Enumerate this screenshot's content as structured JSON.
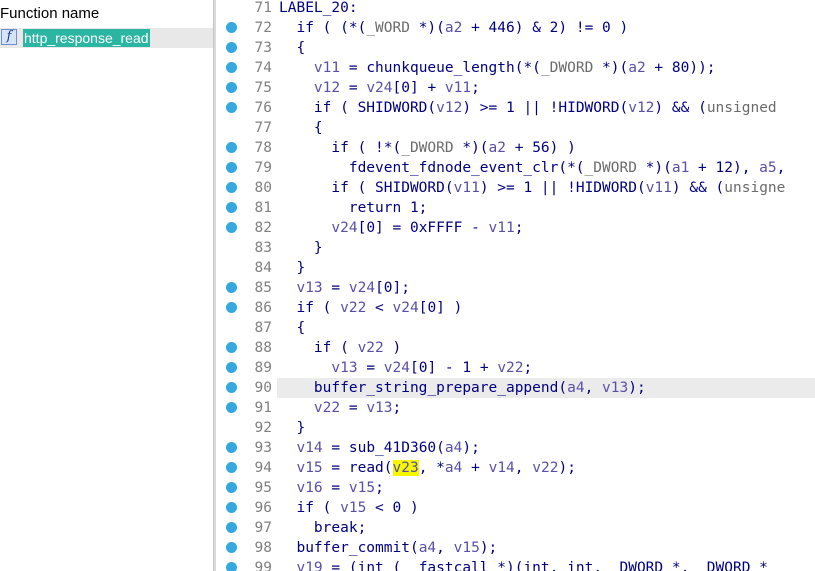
{
  "functions_panel": {
    "header": "Function name",
    "items": [
      {
        "icon": "f",
        "name": "http_response_read",
        "selected": true
      }
    ]
  },
  "code_view": {
    "highlight_line": 90,
    "lines": [
      {
        "num": "71",
        "dot": false,
        "segs": [
          [
            "plain",
            "LABEL_20:"
          ]
        ]
      },
      {
        "num": "72",
        "dot": true,
        "segs": [
          [
            "plain",
            "  if ( (*("
          ],
          [
            "type",
            "_WORD"
          ],
          [
            "plain",
            " *)("
          ],
          [
            "var",
            "a2"
          ],
          [
            "plain",
            " + 446) & 2) != 0 )"
          ]
        ]
      },
      {
        "num": "73",
        "dot": true,
        "segs": [
          [
            "plain",
            "  {"
          ]
        ]
      },
      {
        "num": "74",
        "dot": true,
        "segs": [
          [
            "plain",
            "    "
          ],
          [
            "var",
            "v11"
          ],
          [
            "plain",
            " = chunkqueue_length(*("
          ],
          [
            "type",
            "_DWORD"
          ],
          [
            "plain",
            " *)("
          ],
          [
            "var",
            "a2"
          ],
          [
            "plain",
            " + 80));"
          ]
        ]
      },
      {
        "num": "75",
        "dot": true,
        "segs": [
          [
            "plain",
            "    "
          ],
          [
            "var",
            "v12"
          ],
          [
            "plain",
            " = "
          ],
          [
            "var",
            "v24"
          ],
          [
            "plain",
            "[0] + "
          ],
          [
            "var",
            "v11"
          ],
          [
            "plain",
            ";"
          ]
        ]
      },
      {
        "num": "76",
        "dot": true,
        "segs": [
          [
            "plain",
            "    if ( SHIDWORD("
          ],
          [
            "var",
            "v12"
          ],
          [
            "plain",
            ") >= 1 || !HIDWORD("
          ],
          [
            "var",
            "v12"
          ],
          [
            "plain",
            ") && ("
          ],
          [
            "type",
            "unsigned"
          ]
        ]
      },
      {
        "num": "77",
        "dot": false,
        "segs": [
          [
            "plain",
            "    {"
          ]
        ]
      },
      {
        "num": "78",
        "dot": true,
        "segs": [
          [
            "plain",
            "      if ( !*("
          ],
          [
            "type",
            "_DWORD"
          ],
          [
            "plain",
            " *)("
          ],
          [
            "var",
            "a2"
          ],
          [
            "plain",
            " + 56) )"
          ]
        ]
      },
      {
        "num": "79",
        "dot": true,
        "segs": [
          [
            "plain",
            "        fdevent_fdnode_event_clr(*("
          ],
          [
            "type",
            "_DWORD"
          ],
          [
            "plain",
            " *)("
          ],
          [
            "var",
            "a1"
          ],
          [
            "plain",
            " + 12), "
          ],
          [
            "var",
            "a5"
          ],
          [
            "plain",
            ","
          ]
        ]
      },
      {
        "num": "80",
        "dot": true,
        "segs": [
          [
            "plain",
            "      if ( SHIDWORD("
          ],
          [
            "var",
            "v11"
          ],
          [
            "plain",
            ") >= 1 || !HIDWORD("
          ],
          [
            "var",
            "v11"
          ],
          [
            "plain",
            ") && ("
          ],
          [
            "type",
            "unsigne"
          ]
        ]
      },
      {
        "num": "81",
        "dot": true,
        "segs": [
          [
            "plain",
            "        return 1;"
          ]
        ]
      },
      {
        "num": "82",
        "dot": true,
        "segs": [
          [
            "plain",
            "      "
          ],
          [
            "var",
            "v24"
          ],
          [
            "plain",
            "[0] = 0xFFFF - "
          ],
          [
            "var",
            "v11"
          ],
          [
            "plain",
            ";"
          ]
        ]
      },
      {
        "num": "83",
        "dot": false,
        "segs": [
          [
            "plain",
            "    }"
          ]
        ]
      },
      {
        "num": "84",
        "dot": false,
        "segs": [
          [
            "plain",
            "  }"
          ]
        ]
      },
      {
        "num": "85",
        "dot": true,
        "segs": [
          [
            "plain",
            "  "
          ],
          [
            "var",
            "v13"
          ],
          [
            "plain",
            " = "
          ],
          [
            "var",
            "v24"
          ],
          [
            "plain",
            "[0];"
          ]
        ]
      },
      {
        "num": "86",
        "dot": true,
        "segs": [
          [
            "plain",
            "  if ( "
          ],
          [
            "var",
            "v22"
          ],
          [
            "plain",
            " < "
          ],
          [
            "var",
            "v24"
          ],
          [
            "plain",
            "[0] )"
          ]
        ]
      },
      {
        "num": "87",
        "dot": false,
        "segs": [
          [
            "plain",
            "  {"
          ]
        ]
      },
      {
        "num": "88",
        "dot": true,
        "segs": [
          [
            "plain",
            "    if ( "
          ],
          [
            "var",
            "v22"
          ],
          [
            "plain",
            " )"
          ]
        ]
      },
      {
        "num": "89",
        "dot": true,
        "segs": [
          [
            "plain",
            "      "
          ],
          [
            "var",
            "v13"
          ],
          [
            "plain",
            " = "
          ],
          [
            "var",
            "v24"
          ],
          [
            "plain",
            "[0] - 1 + "
          ],
          [
            "var",
            "v22"
          ],
          [
            "plain",
            ";"
          ]
        ]
      },
      {
        "num": "90",
        "dot": true,
        "segs": [
          [
            "plain",
            "    buffer_string_prepare_append("
          ],
          [
            "var",
            "a4"
          ],
          [
            "plain",
            ", "
          ],
          [
            "var",
            "v13"
          ],
          [
            "plain",
            ");"
          ]
        ]
      },
      {
        "num": "91",
        "dot": true,
        "segs": [
          [
            "plain",
            "    "
          ],
          [
            "var",
            "v22"
          ],
          [
            "plain",
            " = "
          ],
          [
            "var",
            "v13"
          ],
          [
            "plain",
            ";"
          ]
        ]
      },
      {
        "num": "92",
        "dot": false,
        "segs": [
          [
            "plain",
            "  }"
          ]
        ]
      },
      {
        "num": "93",
        "dot": true,
        "segs": [
          [
            "plain",
            "  "
          ],
          [
            "var",
            "v14"
          ],
          [
            "plain",
            " = sub_41D360("
          ],
          [
            "var",
            "a4"
          ],
          [
            "plain",
            ");"
          ]
        ]
      },
      {
        "num": "94",
        "dot": true,
        "segs": [
          [
            "plain",
            "  "
          ],
          [
            "var",
            "v15"
          ],
          [
            "plain",
            " = read("
          ],
          [
            "hit",
            "v23"
          ],
          [
            "plain",
            ", *"
          ],
          [
            "var",
            "a4"
          ],
          [
            "plain",
            " + "
          ],
          [
            "var",
            "v14"
          ],
          [
            "plain",
            ", "
          ],
          [
            "var",
            "v22"
          ],
          [
            "plain",
            ");"
          ]
        ]
      },
      {
        "num": "95",
        "dot": true,
        "segs": [
          [
            "plain",
            "  "
          ],
          [
            "var",
            "v16"
          ],
          [
            "plain",
            " = "
          ],
          [
            "var",
            "v15"
          ],
          [
            "plain",
            ";"
          ]
        ]
      },
      {
        "num": "96",
        "dot": true,
        "segs": [
          [
            "plain",
            "  if ( "
          ],
          [
            "var",
            "v15"
          ],
          [
            "plain",
            " < 0 )"
          ]
        ]
      },
      {
        "num": "97",
        "dot": true,
        "segs": [
          [
            "plain",
            "    break;"
          ]
        ]
      },
      {
        "num": "98",
        "dot": true,
        "segs": [
          [
            "plain",
            "  buffer_commit("
          ],
          [
            "var",
            "a4"
          ],
          [
            "plain",
            ", "
          ],
          [
            "var",
            "v15"
          ],
          [
            "plain",
            ");"
          ]
        ]
      },
      {
        "num": "99",
        "dot": true,
        "segs": [
          [
            "plain",
            "  "
          ],
          [
            "var",
            "v19"
          ],
          [
            "plain",
            " = (int (__fastcall *)(int, int, _DWORD *, _DWORD *"
          ]
        ]
      }
    ]
  }
}
